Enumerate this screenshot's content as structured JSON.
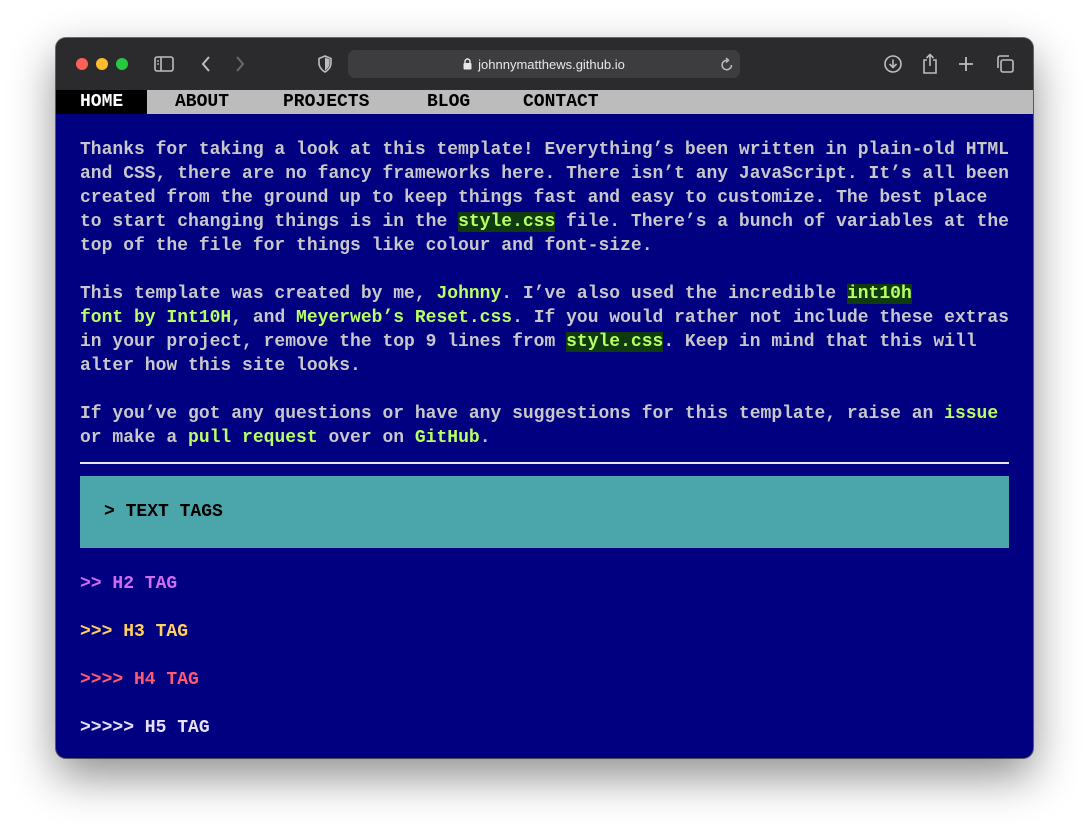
{
  "browser": {
    "url": "johnnymatthews.github.io",
    "icons": [
      "sidebar-icon",
      "back-icon",
      "forward-icon",
      "shield-icon",
      "lock-icon",
      "reload-icon",
      "download-icon",
      "share-icon",
      "new-tab-icon",
      "tabs-overview-icon"
    ]
  },
  "nav": {
    "items": [
      {
        "label": "HOME",
        "active": true
      },
      {
        "label": "ABOUT"
      },
      {
        "label": "PROJECTS"
      },
      {
        "label": "BLOG"
      },
      {
        "label": "CONTACT"
      }
    ]
  },
  "content": {
    "p1": {
      "t1": "Thanks for taking a look at this template! Everything’s been written in plain-old HTML and CSS, there are no fancy frameworks here. There isn’t any JavaScript. It’s all been created from the ground up to keep things fast and easy to customize. The best place to start changing things is in the ",
      "code1": "style.css",
      "t2": " file. There’s a bunch of variables at the top of the file for things like colour and font-size."
    },
    "p2": {
      "t1": "This template was created by me, ",
      "link1": "Johnny",
      "t2": ". I’ve also used the incredible ",
      "link2": "int10h",
      "link2b": "font by Int10H",
      "t3": ", and ",
      "link3": "Meyerweb’s Reset.css",
      "t4": ". If you would rather not include these extras in your project, remove the top 9 lines from ",
      "code1": "style.css",
      "t5": ". Keep in mind that this will alter how this site looks."
    },
    "p3": {
      "t1": "If you’ve got any questions or have any suggestions for this template, raise an ",
      "link1": "issue",
      "t2": " or make a ",
      "link2": "pull request",
      "t3": " over on ",
      "link3": "GitHub",
      "t4": "."
    },
    "section_title": "> TEXT TAGS",
    "headings": {
      "h2": ">> H2 TAG",
      "h3": ">>> H3 TAG",
      "h4": ">>>> H4 TAG",
      "h5": ">>>>> H5 TAG"
    }
  },
  "colors": {
    "page_bg": "#000080",
    "text": "#c8c8c8",
    "link": "#b6ff64",
    "nav_bg": "#bcbcbc",
    "section_bg": "#4aa6aa",
    "h2": "#d06cf0",
    "h3": "#ffd060",
    "h4": "#ff5a6e",
    "h5": "#e8e0ff"
  }
}
